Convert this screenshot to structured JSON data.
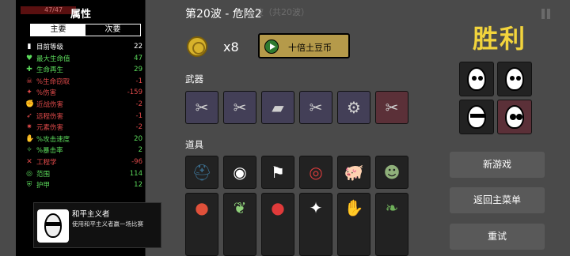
{
  "stats": {
    "title": "属性",
    "hp_strip": "47/47",
    "tabs": [
      "主要",
      "次要"
    ],
    "rows": [
      {
        "icon": "level-icon",
        "glyph": "▮",
        "label": "目前等级",
        "value": "22",
        "label_color": "#ffffff",
        "value_color": "#ffffff"
      },
      {
        "icon": "heart-icon",
        "glyph": "♥",
        "label": "最大生命值",
        "value": "47",
        "label_color": "#5cdb5c",
        "value_color": "#5cdb5c"
      },
      {
        "icon": "regen-icon",
        "glyph": "✚",
        "label": "生命再生",
        "value": "29",
        "label_color": "#5cdb5c",
        "value_color": "#5cdb5c"
      },
      {
        "icon": "lifesteal-icon",
        "glyph": "☠",
        "label": "%生命窃取",
        "value": "-1",
        "label_color": "#e04a4a",
        "value_color": "#e04a4a"
      },
      {
        "icon": "damage-icon",
        "glyph": "✦",
        "label": "%伤害",
        "value": "-159",
        "label_color": "#e04a4a",
        "value_color": "#e04a4a"
      },
      {
        "icon": "melee-icon",
        "glyph": "✊",
        "label": "近战伤害",
        "value": "-2",
        "label_color": "#e04a4a",
        "value_color": "#e04a4a"
      },
      {
        "icon": "ranged-icon",
        "glyph": "➶",
        "label": "远程伤害",
        "value": "-1",
        "label_color": "#e04a4a",
        "value_color": "#e04a4a"
      },
      {
        "icon": "elemental-icon",
        "glyph": "✷",
        "label": "元素伤害",
        "value": "-2",
        "label_color": "#e04a4a",
        "value_color": "#e04a4a"
      },
      {
        "icon": "attack-speed-icon",
        "glyph": "✋",
        "label": "%攻击速度",
        "value": "20",
        "label_color": "#5cdb5c",
        "value_color": "#5cdb5c"
      },
      {
        "icon": "crit-icon",
        "glyph": "✧",
        "label": "%暴击率",
        "value": "2",
        "label_color": "#5cdb5c",
        "value_color": "#5cdb5c"
      },
      {
        "icon": "engineering-icon",
        "glyph": "✕",
        "label": "工程学",
        "value": "-96",
        "label_color": "#e04a4a",
        "value_color": "#e04a4a"
      },
      {
        "icon": "range-icon",
        "glyph": "◎",
        "label": "范围",
        "value": "114",
        "label_color": "#5cdb5c",
        "value_color": "#5cdb5c"
      },
      {
        "icon": "armor-icon",
        "glyph": "⛨",
        "label": "护甲",
        "value": "12",
        "label_color": "#5cdb5c",
        "value_color": "#5cdb5c"
      }
    ]
  },
  "tooltip": {
    "name": "和平主义者",
    "desc": "使用和平主义者赢一场比赛"
  },
  "header": {
    "wave": "第20波 - 危险2",
    "wave_faded": "波（共20波）"
  },
  "currency": {
    "count": "x8",
    "button_label": "十倍土豆币"
  },
  "sections": {
    "weapons": "武器",
    "items": "道具"
  },
  "weapons": [
    {
      "name": "pliers-icon",
      "glyph": "✂",
      "tier": "blue"
    },
    {
      "name": "scissors-icon",
      "glyph": "✂",
      "tier": "blue"
    },
    {
      "name": "taser-icon",
      "glyph": "▰",
      "tier": "blue"
    },
    {
      "name": "scissors-icon-2",
      "glyph": "✂",
      "tier": "blue"
    },
    {
      "name": "saw-blade-icon",
      "glyph": "⚙",
      "tier": "blue"
    },
    {
      "name": "scissors-icon-3",
      "glyph": "✂",
      "tier": "red"
    }
  ],
  "items_row1": [
    {
      "name": "helmet-icon",
      "glyph": "⛑"
    },
    {
      "name": "ninja-egg-icon",
      "glyph": "◉"
    },
    {
      "name": "white-flag-icon",
      "glyph": "⚑"
    },
    {
      "name": "life-ring-icon",
      "glyph": "◎"
    },
    {
      "name": "pig-icon",
      "glyph": "🐖"
    },
    {
      "name": "zombie-icon",
      "glyph": "☻"
    }
  ],
  "items_row2": [
    {
      "name": "tomato-icon",
      "glyph": "●"
    },
    {
      "name": "plant-icon",
      "glyph": "❦"
    },
    {
      "name": "boxing-glove-icon",
      "glyph": "●"
    },
    {
      "name": "claw-icon",
      "glyph": "✦"
    },
    {
      "name": "hand-icon",
      "glyph": "✋"
    },
    {
      "name": "sprout-icon",
      "glyph": "❧"
    }
  ],
  "result": {
    "title": "胜利"
  },
  "characters": [
    {
      "name": "goofy-egg-icon",
      "tier": "normal"
    },
    {
      "name": "spotted-egg-icon",
      "tier": "normal"
    },
    {
      "name": "masked-egg-icon",
      "tier": "normal"
    },
    {
      "name": "panda-egg-icon",
      "tier": "red"
    }
  ],
  "menu": {
    "new_game": "新游戏",
    "main_menu": "返回主菜单",
    "retry": "重试"
  },
  "colors": {
    "victory": "#f2d43c",
    "positive": "#5cdb5c",
    "negative": "#e04a4a",
    "coin_button": "#b59a4a"
  }
}
